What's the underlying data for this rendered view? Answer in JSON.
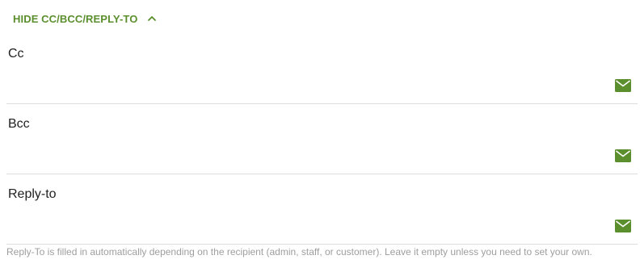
{
  "toggle": {
    "label": "HIDE CC/BCC/REPLY-TO",
    "icon": "chevron-up-icon"
  },
  "fields": [
    {
      "label": "Cc",
      "value": "",
      "icon": "mail-icon"
    },
    {
      "label": "Bcc",
      "value": "",
      "icon": "mail-icon"
    },
    {
      "label": "Reply-to",
      "value": "",
      "icon": "mail-icon"
    }
  ],
  "hint": "Reply-To is filled in automatically depending on the recipient (admin, staff, or customer). Leave it empty unless you need to set your own.",
  "colors": {
    "accent": "#5b8f2e",
    "divider": "#dcdcdc",
    "hint": "#9e9e9e"
  }
}
